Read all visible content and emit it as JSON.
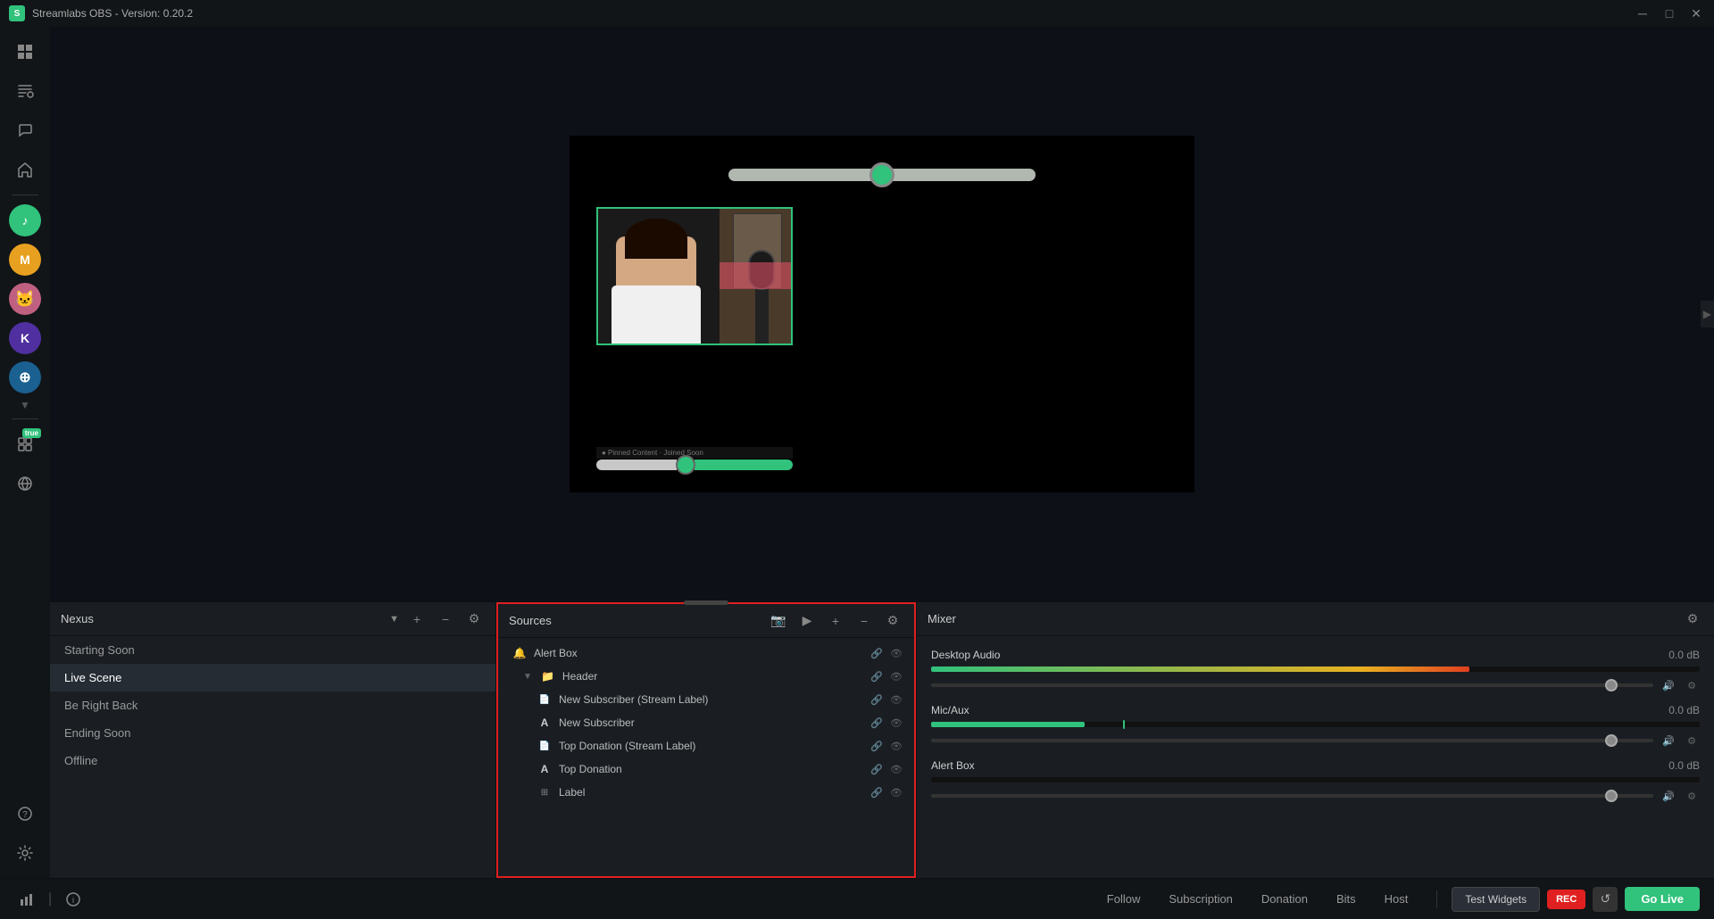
{
  "titleBar": {
    "title": "Streamlabs OBS - Version: 0.20.2",
    "logoText": "S",
    "controls": [
      "─",
      "□",
      "✕"
    ]
  },
  "sidebar": {
    "icons": [
      {
        "name": "scenes-icon",
        "symbol": "⊞",
        "active": true
      },
      {
        "name": "editor-icon",
        "symbol": "✦"
      },
      {
        "name": "chat-icon",
        "symbol": "💬"
      },
      {
        "name": "home-icon",
        "symbol": "⌂"
      }
    ],
    "avatars": [
      {
        "name": "avatar-green",
        "color": "#31c27c",
        "symbol": "♪"
      },
      {
        "name": "avatar-m",
        "color": "#e8a020",
        "symbol": "M"
      },
      {
        "name": "avatar-cat",
        "color": "#c06080",
        "symbol": "🐱"
      },
      {
        "name": "avatar-k",
        "color": "#6040b0",
        "symbol": "K"
      },
      {
        "name": "avatar-multi",
        "color": "#2080c0",
        "symbol": "⊕"
      }
    ],
    "bottomIcons": [
      {
        "name": "plugins-icon",
        "symbol": "✦",
        "hasNew": true
      },
      {
        "name": "globe-icon",
        "symbol": "🌐"
      },
      {
        "name": "history-icon",
        "symbol": "○"
      },
      {
        "name": "grid-icon",
        "symbol": "⊞"
      },
      {
        "name": "chart-icon",
        "symbol": "▐"
      },
      {
        "name": "help-icon",
        "symbol": "?"
      },
      {
        "name": "send-icon",
        "symbol": "↗"
      },
      {
        "name": "settings-icon",
        "symbol": "⚙"
      }
    ]
  },
  "scenes": {
    "title": "Nexus",
    "items": [
      {
        "label": "Starting Soon",
        "active": false
      },
      {
        "label": "Live Scene",
        "active": true
      },
      {
        "label": "Be Right Back",
        "active": false
      },
      {
        "label": "Ending Soon",
        "active": false
      },
      {
        "label": "Offline",
        "active": false
      }
    ]
  },
  "sources": {
    "title": "Sources",
    "items": [
      {
        "label": "Alert Box",
        "icon": "🔔",
        "indent": 0,
        "type": "alert"
      },
      {
        "label": "Header",
        "icon": "📁",
        "indent": 1,
        "type": "folder",
        "collapsed": true
      },
      {
        "label": "New Subscriber (Stream Label)",
        "icon": "📄",
        "indent": 2,
        "type": "label"
      },
      {
        "label": "New Subscriber",
        "icon": "A",
        "indent": 2,
        "type": "alert"
      },
      {
        "label": "Top Donation (Stream Label)",
        "icon": "📄",
        "indent": 2,
        "type": "label"
      },
      {
        "label": "Top Donation",
        "icon": "A",
        "indent": 2,
        "type": "alert"
      },
      {
        "label": "Label",
        "icon": "⊞",
        "indent": 2,
        "type": "other"
      }
    ]
  },
  "mixer": {
    "title": "Mixer",
    "items": [
      {
        "name": "Desktop Audio",
        "db": "0.0 dB",
        "fillColor": "#e8b020",
        "fillWidth": 70
      },
      {
        "name": "Mic/Aux",
        "db": "0.0 dB",
        "fillColor": "#31c27c",
        "fillWidth": 20
      },
      {
        "name": "Alert Box",
        "db": "0.0 dB",
        "fillColor": "#31c27c",
        "fillWidth": 0
      }
    ]
  },
  "bottomBar": {
    "tabs": [
      "Follow",
      "Subscription",
      "Donation",
      "Bits",
      "Host"
    ],
    "testWidgets": "Test Widgets",
    "recLabel": "REC",
    "goLive": "Go Live"
  }
}
